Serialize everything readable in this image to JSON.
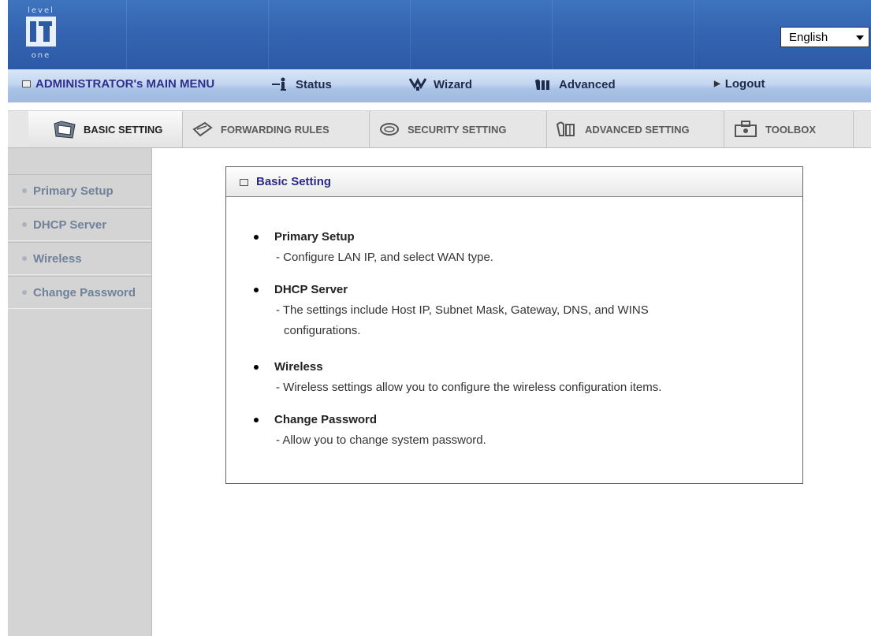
{
  "brand": {
    "logo_top": "level",
    "logo_bottom": "one"
  },
  "language": {
    "selected": "English"
  },
  "main_menu": {
    "admin": "ADMINISTRATOR's MAIN MENU",
    "status": "Status",
    "wizard": "Wizard",
    "advanced": "Advanced",
    "logout": "Logout"
  },
  "tabs": [
    {
      "label": "BASIC SETTING"
    },
    {
      "label": "FORWARDING RULES"
    },
    {
      "label": "SECURITY SETTING"
    },
    {
      "label": "ADVANCED SETTING"
    },
    {
      "label": "TOOLBOX"
    }
  ],
  "sidebar": {
    "items": [
      {
        "label": "Primary Setup"
      },
      {
        "label": "DHCP Server"
      },
      {
        "label": "Wireless"
      },
      {
        "label": "Change Password"
      }
    ]
  },
  "panel": {
    "title": "Basic Setting",
    "entries": [
      {
        "title": "Primary Setup",
        "desc_line1": "- Configure LAN IP, and select WAN type.",
        "desc_line2": ""
      },
      {
        "title": "DHCP Server",
        "desc_line1": "- The settings include Host IP, Subnet Mask, Gateway, DNS, and WINS",
        "desc_line2": "configurations."
      },
      {
        "title": "Wireless",
        "desc_line1": "- Wireless settings allow you to configure the wireless configuration items.",
        "desc_line2": ""
      },
      {
        "title": "Change Password",
        "desc_line1": "- Allow you to change system password.",
        "desc_line2": ""
      }
    ]
  },
  "colors": {
    "header_blue": "#3566b3",
    "menu_text": "#1f2b4d",
    "panel_title": "#2d2a86",
    "sidebar_text": "#6f8299",
    "sidebar_bg": "#d4d4d4"
  }
}
